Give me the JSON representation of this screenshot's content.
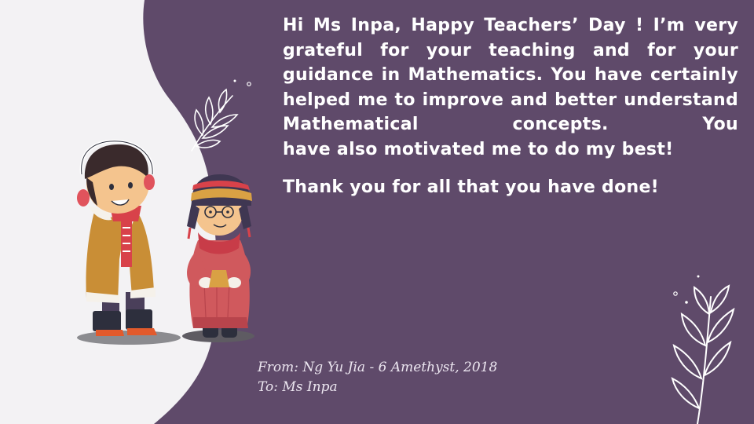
{
  "card": {
    "background_color": "#5f4a6a",
    "curve_color": "#f3f2f4",
    "message_line_1_to_5": "Hi Ms Inpa,  Happy Teachers’ Day ! I’m very grateful for your teaching and for your guidance in Mathematics. You have certainly helped me to improve and better understand Mathematical concepts. You",
    "message_line_6": "have also motivated me to do my best!",
    "thanks": "Thank you for all that you have done!",
    "from": "From: Ng Yu Jia - 6 Amethyst, 2018",
    "to": "To: Ms Inpa"
  },
  "illustrations": {
    "characters": [
      "boy-with-earmuffs-and-scarf",
      "girl-with-glasses-and-winter-hat"
    ],
    "decorations": [
      "leaf-sprig-icon",
      "leaf-sprig-icon",
      "dot-icon"
    ]
  }
}
